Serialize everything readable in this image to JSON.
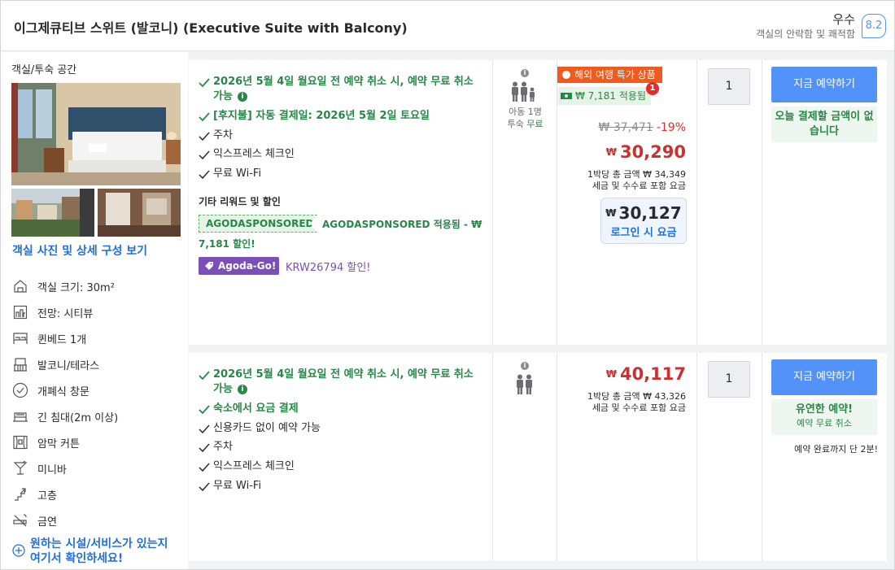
{
  "header": {
    "room_title": "이그제큐티브 스위트 (발코니) (Executive Suite with Balcony)",
    "rating_word": "우수",
    "rating_sub": "객실의 안락함 및 쾌적함",
    "rating_score": "8.2"
  },
  "room_info": {
    "label": "객실/투숙 공간",
    "photos_link": "객실 사진 및 상세 구성 보기",
    "features": [
      {
        "icon": "room-size-icon",
        "label": "객실 크기: 30m²"
      },
      {
        "icon": "city-view-icon",
        "label": "전망: 시티뷰"
      },
      {
        "icon": "queen-bed-icon",
        "label": "퀸베드 1개"
      },
      {
        "icon": "balcony-icon",
        "label": "발코니/테라스"
      },
      {
        "icon": "window-icon",
        "label": "개폐식 창문"
      },
      {
        "icon": "long-bed-icon",
        "label": "긴 침대(2m 이상)"
      },
      {
        "icon": "curtain-icon",
        "label": "암막 커튼"
      },
      {
        "icon": "minibar-icon",
        "label": "미니바"
      },
      {
        "icon": "high-floor-icon",
        "label": "고층"
      },
      {
        "icon": "no-smoking-icon",
        "label": "금연"
      }
    ],
    "ask_link_line1": "원하는 시설/서비스가 있는지",
    "ask_link_line2": "여기서 확인하세요!"
  },
  "offers": [
    {
      "benefits": [
        {
          "text": "2026년 5월 4일 월요일 전 예약 취소 시, 예약 무료 취소 가능",
          "style": "green"
        },
        {
          "text": "[후지불] 자동 결제일: 2026년 5월 2일 토요일",
          "style": "green"
        },
        {
          "text": "주차",
          "style": "black"
        },
        {
          "text": "익스프레스 체크인",
          "style": "black"
        },
        {
          "text": "무료 Wi-Fi",
          "style": "black"
        }
      ],
      "other_title": "기타 리워드 및 할인",
      "promo_code": "AGODASPONSORED",
      "promo_text": "AGODASPONSORED 적용됨 - ₩ 7,181 할인!",
      "agoda_go_label": "Agoda-Go!",
      "agoda_go_text": "KRW26794 할인!",
      "occupancy": {
        "child_line": "아동 1명",
        "child_stay": "투숙",
        "child_free": "무료"
      },
      "deal_badge": "해외 여행 특가 상품",
      "cashback": "₩ 7,181 적용됨",
      "cashback_count": "1",
      "original_price": "₩ 37,471",
      "discount": "-19%",
      "currency": "₩",
      "price": "30,290",
      "per_night": "1박당 총 금액 ₩ 34,349",
      "tax_note": "세금 및 수수료 포함 요금",
      "login_price": "30,127",
      "login_label": "로그인 시 요금",
      "qty": "1",
      "book_label": "지금 예약하기",
      "pay_note": "오늘 결제할 금액이 없습니다"
    },
    {
      "benefits": [
        {
          "text": "2026년 5월 4일 월요일 전 예약 취소 시, 예약 무료 취소 가능",
          "style": "green"
        },
        {
          "text": "숙소에서 요금 결제",
          "style": "green"
        },
        {
          "text": "신용카드 없이 예약 가능",
          "style": "black"
        },
        {
          "text": "주차",
          "style": "black"
        },
        {
          "text": "익스프레스 체크인",
          "style": "black"
        },
        {
          "text": "무료 Wi-Fi",
          "style": "black"
        }
      ],
      "currency": "₩",
      "price": "40,117",
      "per_night": "1박당 총 금액 ₩ 43,326",
      "tax_note": "세금 및 수수료 포함 요금",
      "qty": "1",
      "book_label": "지금 예약하기",
      "flex_title": "유연한 예약!",
      "flex_sub": "예약 무료 취소",
      "minutes_left": "예약 완료까지 단 2분!"
    }
  ],
  "colors": {
    "accent_blue": "#5392f9",
    "link_blue": "#1f6fdb",
    "green": "#278747",
    "price_red": "#c83232",
    "deal_orange": "#f05a1c",
    "agoda_go_purple": "#7b4fb8"
  }
}
